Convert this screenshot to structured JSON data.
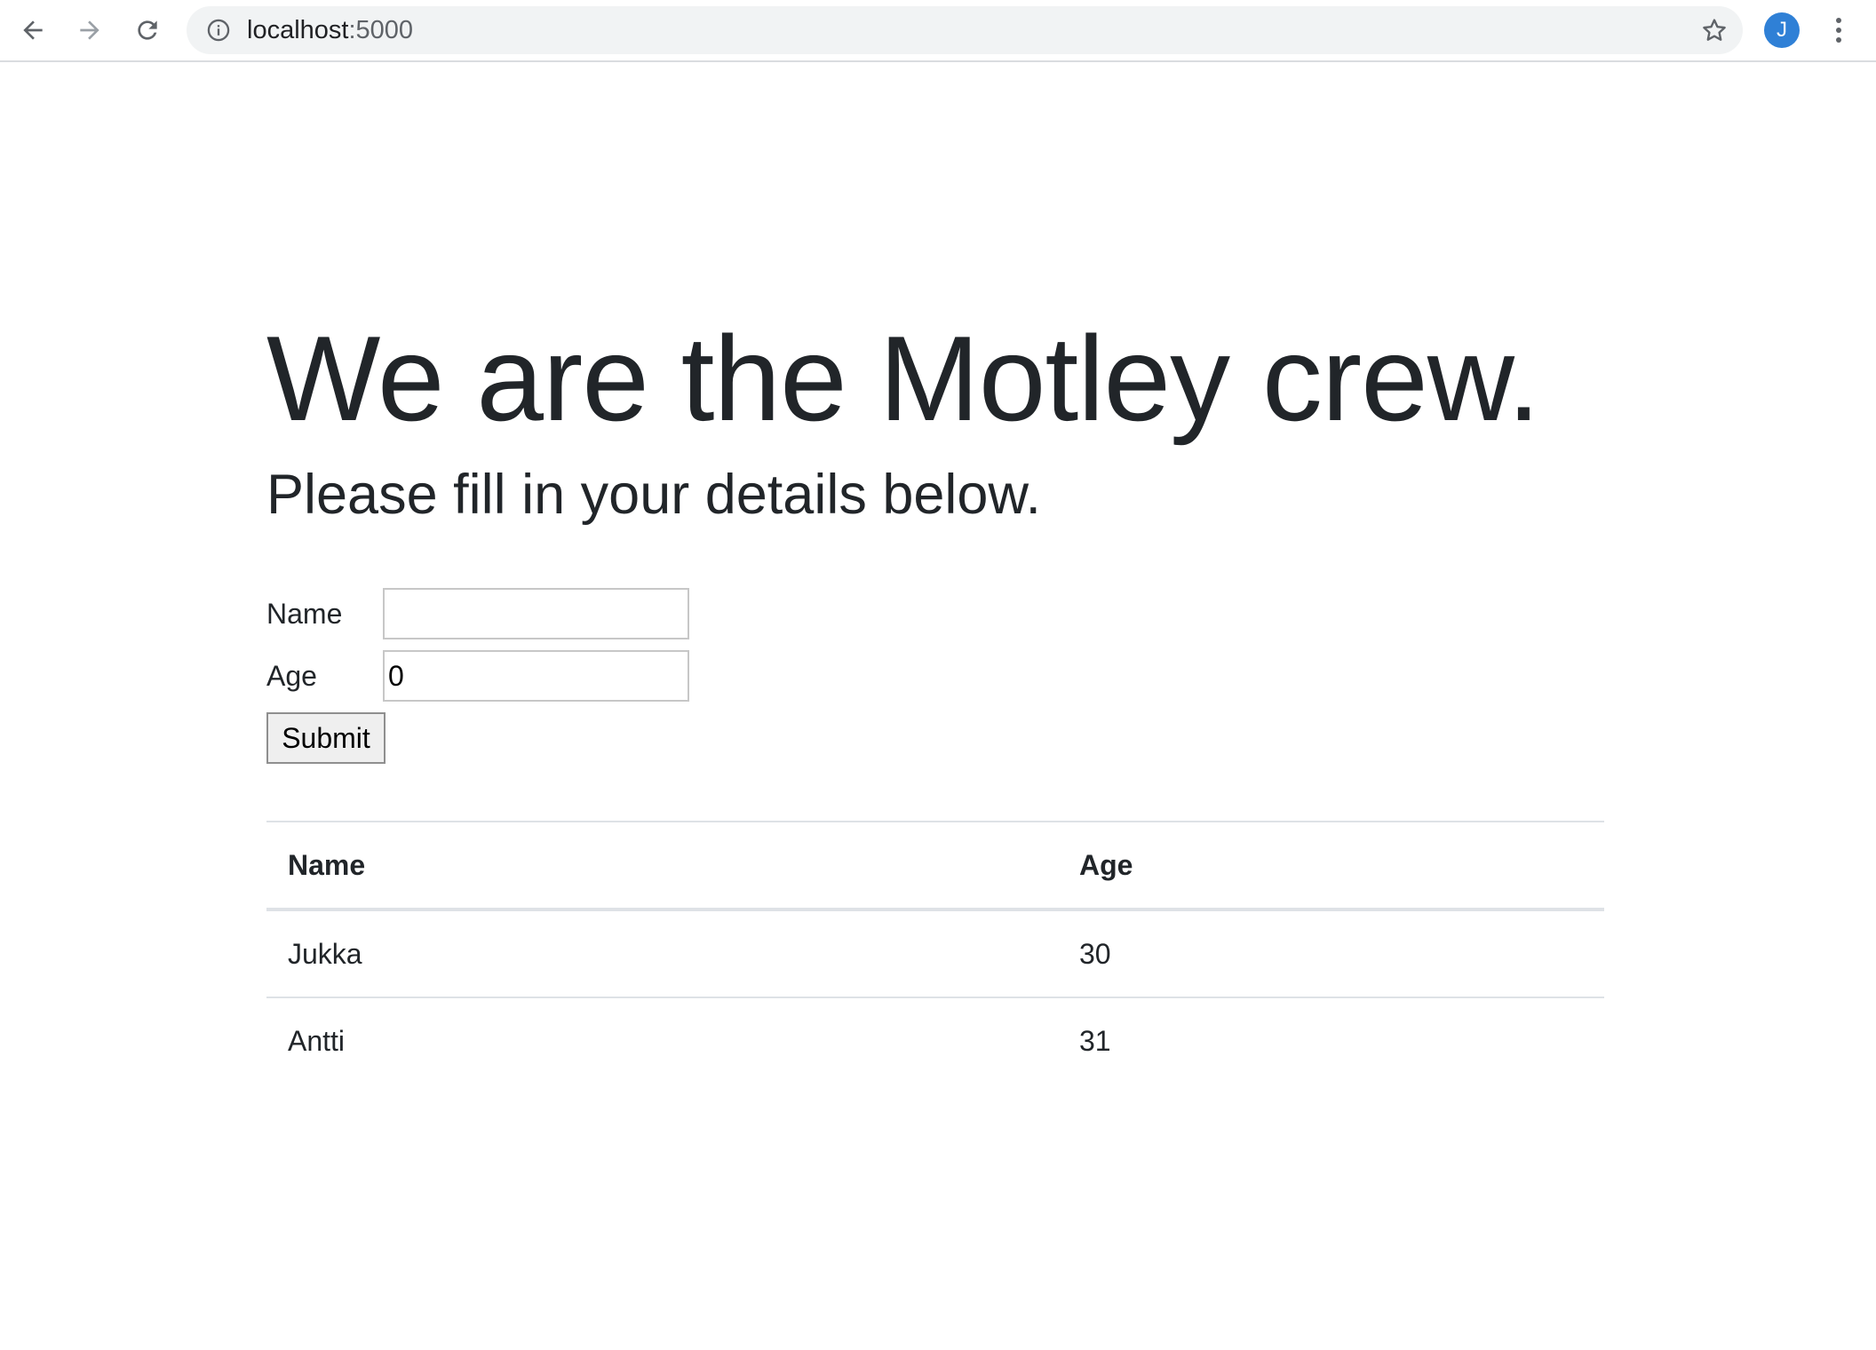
{
  "browser": {
    "url_host": "localhost",
    "url_port": ":5000",
    "avatar_letter": "J"
  },
  "page": {
    "heading": "We are the Motley crew.",
    "subheading": "Please fill in your details below.",
    "form": {
      "name_label": "Name",
      "name_value": "",
      "age_label": "Age",
      "age_value": "0",
      "submit_label": "Submit"
    },
    "table": {
      "headers": [
        "Name",
        "Age"
      ],
      "rows": [
        {
          "name": "Jukka",
          "age": "30"
        },
        {
          "name": "Antti",
          "age": "31"
        }
      ]
    }
  },
  "colors": {
    "text": "#212529",
    "avatar": "#2f80d6",
    "omnibox": "#f1f3f4",
    "table_border": "#dee2e6"
  },
  "icons": [
    "back-arrow-icon",
    "forward-arrow-icon",
    "reload-icon",
    "info-icon",
    "star-icon",
    "more-vert-icon"
  ]
}
